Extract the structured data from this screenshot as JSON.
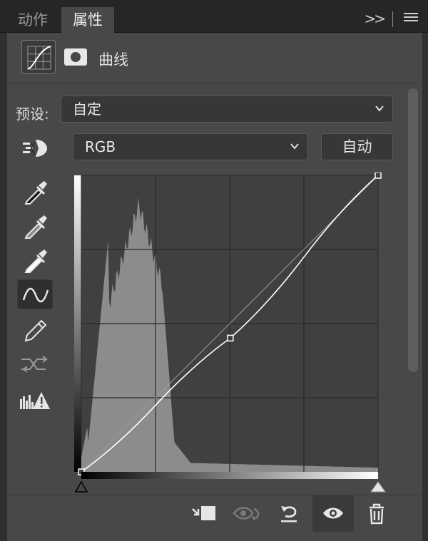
{
  "tabs": {
    "actions": "动作",
    "properties": "属性",
    "more": "»"
  },
  "adjustment": {
    "type_label": "曲线"
  },
  "preset": {
    "label": "预设:",
    "value": "自定"
  },
  "channel": {
    "value": "RGB"
  },
  "auto_label": "自动",
  "tools": [
    "target-adjust-icon",
    "eyedropper-black-icon",
    "eyedropper-gray-icon",
    "eyedropper-white-icon",
    "curve-point-icon",
    "pencil-icon",
    "smooth-icon",
    "clipping-warning-icon"
  ],
  "curve": {
    "points": [
      [
        0,
        0
      ],
      [
        128,
        115
      ],
      [
        255,
        255
      ]
    ],
    "grid_divisions": 4
  },
  "bottom_icons": [
    "clip-to-layer-icon",
    "view-previous-icon",
    "reset-icon",
    "visibility-eye-icon",
    "trash-icon"
  ],
  "colors": {
    "panel": "#484848",
    "tabbar": "#262626",
    "histogram": "#8c8c8c",
    "curve": "#ffffff"
  }
}
